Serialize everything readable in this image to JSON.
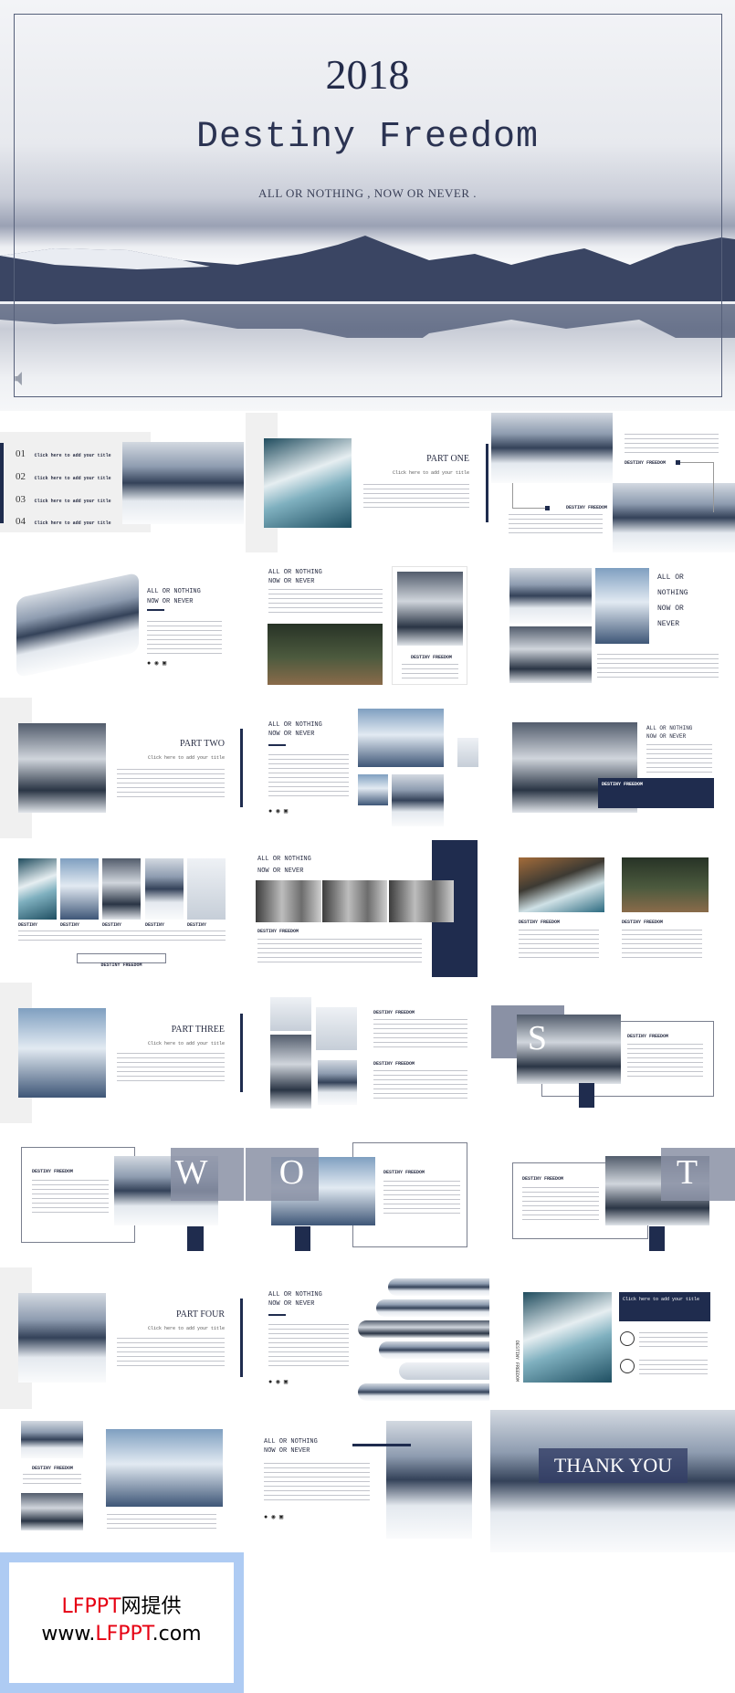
{
  "hero": {
    "year": "2018",
    "title": "Destiny Freedom",
    "subtitle": "ALL OR NOTHING , NOW OR NEVER .",
    "speaker_icon": "speaker-icon"
  },
  "agenda": {
    "items": [
      {
        "number": "01",
        "label": "Click here to add your title"
      },
      {
        "number": "02",
        "label": "Click here to add your title"
      },
      {
        "number": "03",
        "label": "Click here to add your title"
      },
      {
        "number": "04",
        "label": "Click here to add your title"
      }
    ]
  },
  "parts": {
    "one": "PART ONE",
    "two": "PART TWO",
    "three": "PART THREE",
    "four": "PART FOUR",
    "subtitle": "Click here to add your title"
  },
  "common": {
    "line1": "ALL OR NOTHING",
    "line2": "NOW OR NEVER",
    "destiny_freedom": "DESTINY FREEDOM",
    "destiny": "DESTINY",
    "all_or": "ALL OR",
    "nothing": "NOTHING",
    "now_or": "NOW OR",
    "never": "NEVER",
    "click_title": "Click here to add your title"
  },
  "social_icons": [
    "wechat-icon",
    "weibo-icon",
    "facebook-icon"
  ],
  "swot": {
    "s": "S",
    "w": "W",
    "o": "O",
    "t": "T"
  },
  "thanks": "THANK YOU",
  "watermark": {
    "brand": "LFPPT",
    "suffix": "网提供",
    "url_prefix": "www.",
    "url_brand": "LFPPT",
    "url_suffix": ".com"
  },
  "colors": {
    "navy": "#1f2c4e",
    "slate": "#8a91a5",
    "watermark_red": "#e60012",
    "watermark_border": "#aecbf3"
  }
}
